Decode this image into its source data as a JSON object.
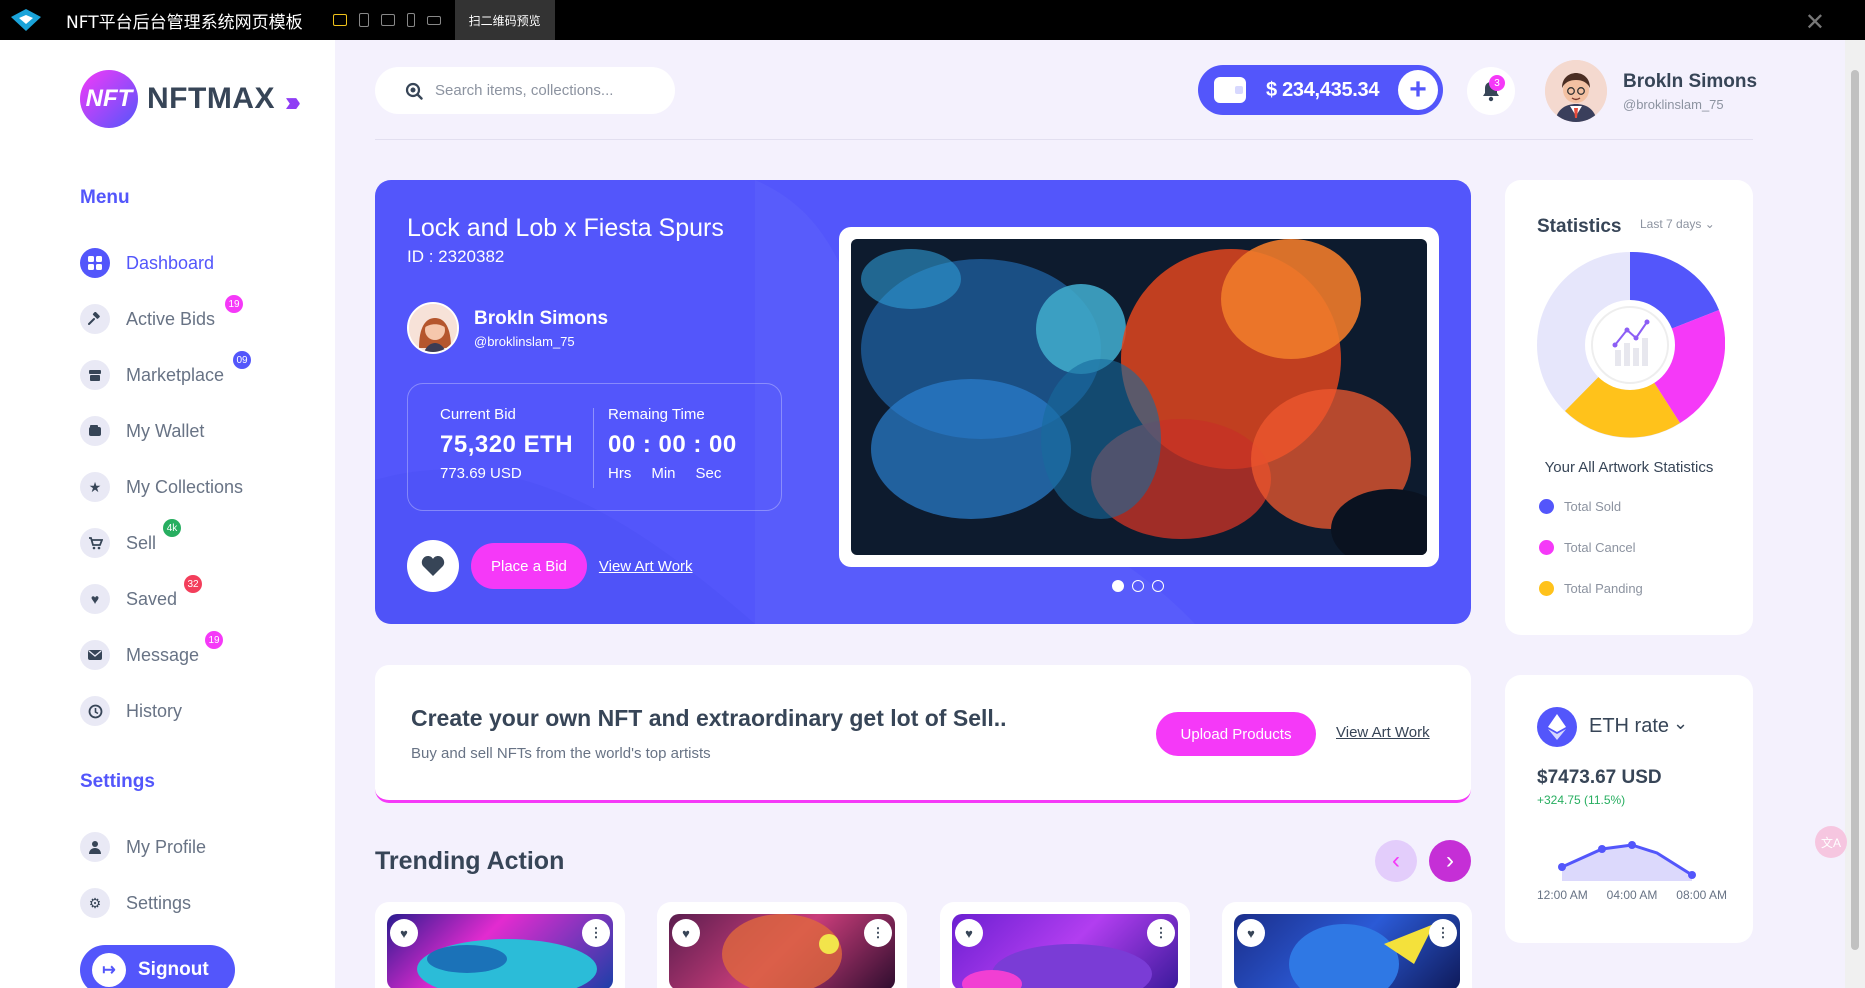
{
  "window": {
    "title": "NFT平台后台管理系统网页模板",
    "qr_preview": "扫二维码预览",
    "close": "✕"
  },
  "brand": {
    "logo_text": "NFT",
    "name": "NFTMAX",
    "toggle": "»"
  },
  "sidebar": {
    "menu_title": "Menu",
    "menu_items": [
      {
        "label": "Dashboard",
        "icon": "dashboard-icon",
        "active": true
      },
      {
        "label": "Active Bids",
        "icon": "gavel-icon",
        "badge": "19"
      },
      {
        "label": "Marketplace",
        "icon": "store-icon",
        "badge": "09"
      },
      {
        "label": "My Wallet",
        "icon": "wallet-icon"
      },
      {
        "label": "My Collections",
        "icon": "star-icon"
      },
      {
        "label": "Sell",
        "icon": "cart-icon",
        "badge": "4k"
      },
      {
        "label": "Saved",
        "icon": "heart-icon",
        "badge": "32"
      },
      {
        "label": "Message",
        "icon": "mail-icon",
        "badge": "19"
      },
      {
        "label": "History",
        "icon": "history-icon"
      }
    ],
    "settings_title": "Settings",
    "settings_items": [
      {
        "label": "My Profile",
        "icon": "user-icon"
      },
      {
        "label": "Settings",
        "icon": "gear-icon"
      }
    ],
    "signout": "Signout"
  },
  "header": {
    "search_placeholder": "Search items, collections...",
    "balance": "$ 234,435.34",
    "add": "+",
    "notification_count": "3",
    "user_name": "Brokln Simons",
    "user_handle": "@broklinslam_75"
  },
  "hero": {
    "title": "Lock and Lob x Fiesta Spurs",
    "id": "ID : 2320382",
    "creator_name": "Brokln Simons",
    "creator_handle": "@broklinslam_75",
    "current_bid_label": "Current Bid",
    "current_bid_value": "75,320 ETH",
    "current_bid_usd": "773.69 USD",
    "remaining_label": "Remaing Time",
    "remaining_value": "00 : 00 : 00",
    "units": [
      "Hrs",
      "Min",
      "Sec"
    ],
    "place_bid": "Place a Bid",
    "view_artwork": "View Art Work"
  },
  "stats": {
    "title": "Statistics",
    "range": "Last 7 days",
    "subtitle": "Your All Artwork Statistics",
    "legend": [
      {
        "label": "Total Sold",
        "color": "#5356fb"
      },
      {
        "label": "Total Cancel",
        "color": "#f539f8"
      },
      {
        "label": "Total Panding",
        "color": "#ffc21b"
      }
    ]
  },
  "create": {
    "title": "Create your own NFT and extraordinary get lot of Sell..",
    "subtitle": "Buy and sell NFTs from the world's top artists",
    "upload": "Upload Products",
    "view_artwork": "View Art Work"
  },
  "eth": {
    "title": "ETH rate",
    "price": "$7473.67 USD",
    "change": "+324.75 (11.5%)",
    "axis": [
      "12:00 AM",
      "04:00 AM",
      "08:00 AM"
    ]
  },
  "trending": {
    "title": "Trending Action",
    "prev": "‹",
    "next": "›"
  },
  "colors": {
    "primary": "#5356fb",
    "accent": "#f539f8",
    "yellow": "#ffc21b",
    "success": "#27ae60"
  }
}
